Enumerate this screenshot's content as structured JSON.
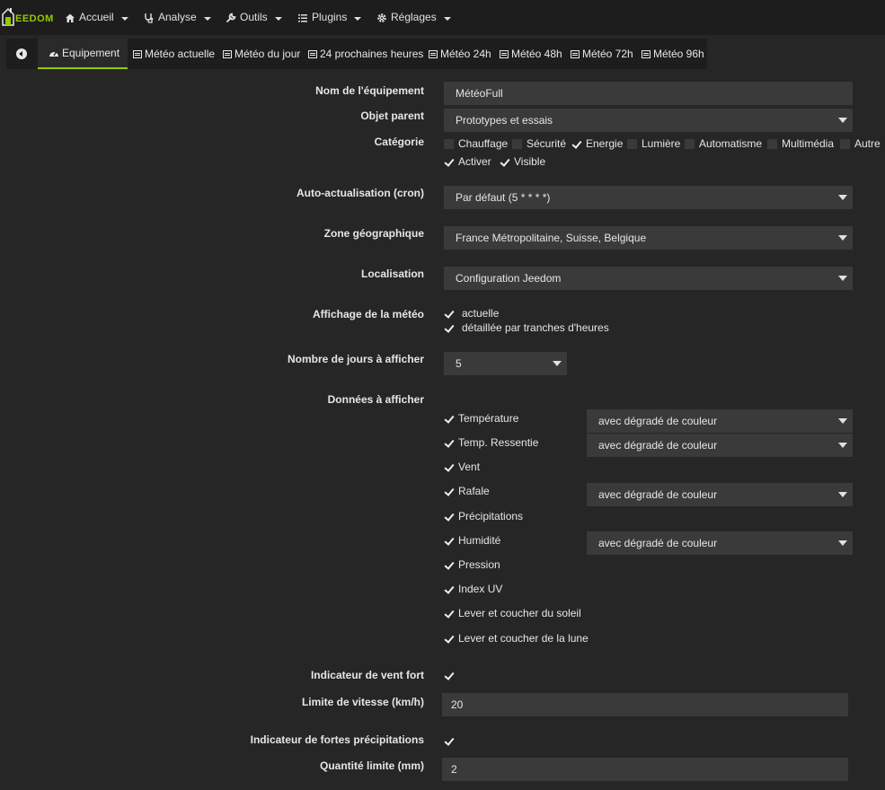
{
  "navbar": {
    "logo_text": "EEDOM",
    "menus": [
      {
        "label": "Accueil"
      },
      {
        "label": "Analyse"
      },
      {
        "label": "Outils"
      },
      {
        "label": "Plugins"
      },
      {
        "label": "Réglages"
      }
    ]
  },
  "tabs": [
    {
      "label": "Equipement"
    },
    {
      "label": "Météo actuelle"
    },
    {
      "label": "Météo du jour"
    },
    {
      "label": "24 prochaines heures"
    },
    {
      "label": "Météo 24h"
    },
    {
      "label": "Météo 48h"
    },
    {
      "label": "Météo 72h"
    },
    {
      "label": "Météo 96h"
    }
  ],
  "form": {
    "name_label": "Nom de l'équipement",
    "name_value": "MétéoFull",
    "parent_label": "Objet parent",
    "parent_value": "Prototypes et essais",
    "category_label": "Catégorie",
    "categories": [
      {
        "label": "Chauffage",
        "checked": false
      },
      {
        "label": "Sécurité",
        "checked": false
      },
      {
        "label": "Energie",
        "checked": true
      },
      {
        "label": "Lumière",
        "checked": false
      },
      {
        "label": "Automatisme",
        "checked": false
      },
      {
        "label": "Multimédia",
        "checked": false
      },
      {
        "label": "Autre",
        "checked": false
      }
    ],
    "activer_label": "Activer",
    "visible_label": "Visible",
    "cron_label": "Auto-actualisation (cron)",
    "cron_value": "Par défaut (5 * * * *)",
    "zone_label": "Zone géographique",
    "zone_value": "France Métropolitaine, Suisse, Belgique",
    "loc_label": "Localisation",
    "loc_value": "Configuration Jeedom",
    "display_label": "Affichage de la météo",
    "display_actuelle": "actuelle",
    "display_detail": "détaillée par tranches d'heures",
    "days_label": "Nombre de jours à afficher",
    "days_value": "5",
    "data_label": "Données à afficher",
    "data_items": [
      {
        "label": "Température",
        "option": "avec dégradé de couleur"
      },
      {
        "label": "Temp. Ressentie",
        "option": "avec dégradé de couleur"
      },
      {
        "label": "Vent",
        "option": ""
      },
      {
        "label": "Rafale",
        "option": "avec dégradé de couleur"
      },
      {
        "label": "Précipitations",
        "option": ""
      },
      {
        "label": "Humidité",
        "option": "avec dégradé de couleur"
      },
      {
        "label": "Pression",
        "option": ""
      },
      {
        "label": "Index UV",
        "option": ""
      },
      {
        "label": "Lever et coucher du soleil",
        "option": ""
      },
      {
        "label": "Lever et coucher de la lune",
        "option": ""
      }
    ],
    "wind_label": "Indicateur de vent fort",
    "speed_label": "Limite de vitesse (km/h)",
    "speed_value": "20",
    "rain_label": "Indicateur de fortes précipitations",
    "qty_label": "Quantité limite (mm)",
    "qty_value": "2"
  },
  "colors": {
    "accent": "#94ca02",
    "background": "#262626",
    "navbar": "#1d1d1d",
    "field": "#3a3a3a"
  }
}
